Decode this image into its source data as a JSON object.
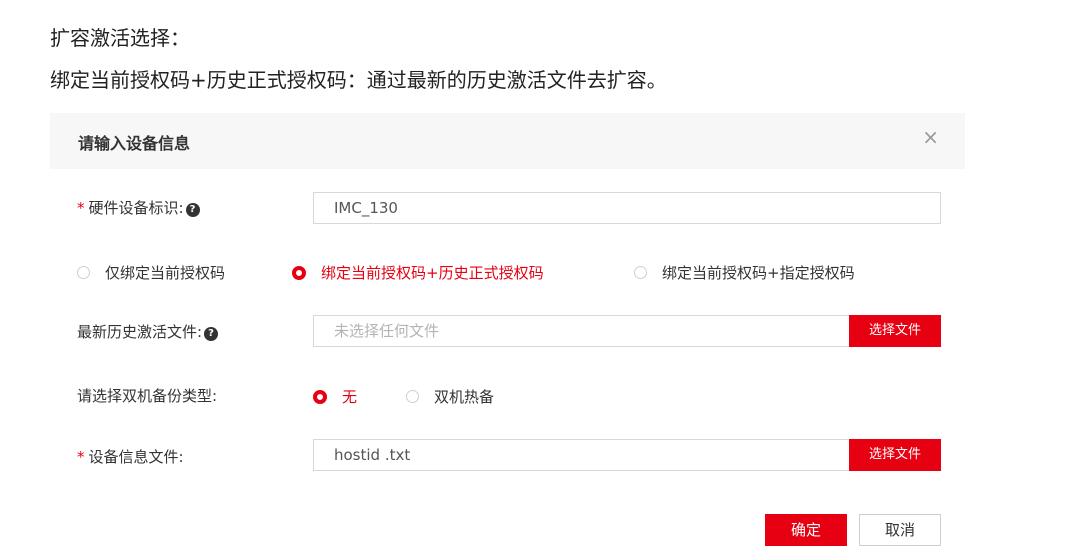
{
  "doc": {
    "line1": "扩容激活选择：",
    "line2": "绑定当前授权码+历史正式授权码：通过最新的历史激活文件去扩容。"
  },
  "dialog": {
    "title": "请输入设备信息",
    "close_glyph": "×"
  },
  "form": {
    "hardware_id": {
      "required_mark": "*",
      "label": "硬件设备标识:",
      "value": "IMC_130"
    },
    "bind_options": [
      {
        "label": "仅绑定当前授权码",
        "checked": false
      },
      {
        "label": "绑定当前授权码+历史正式授权码",
        "checked": true
      },
      {
        "label": "绑定当前授权码+指定授权码",
        "checked": false
      }
    ],
    "latest_history_file": {
      "label": "最新历史激活文件:",
      "placeholder": "未选择任何文件",
      "button_label": "选择文件"
    },
    "backup_type": {
      "label": "请选择双机备份类型:",
      "options": [
        {
          "label": "无",
          "checked": true
        },
        {
          "label": "双机热备",
          "checked": false
        }
      ]
    },
    "device_info_file": {
      "required_mark": "*",
      "label": "设备信息文件:",
      "value": "hostid .txt",
      "button_label": "选择文件"
    }
  },
  "actions": {
    "ok_label": "确定",
    "cancel_label": "取消"
  },
  "colors": {
    "accent": "#e60012",
    "header_bg": "#f7f7f7"
  }
}
